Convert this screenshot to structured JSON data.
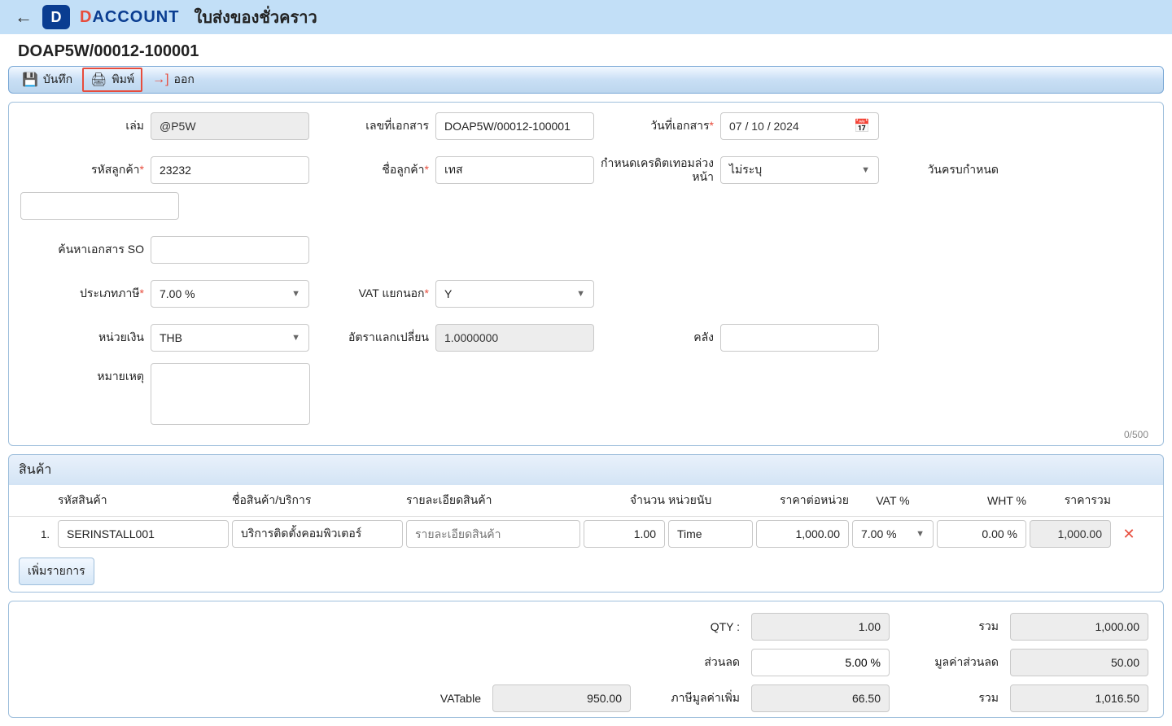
{
  "header": {
    "logo_letter": "D",
    "logo_text_d": "D",
    "logo_text_rest": "ACCOUNT",
    "page_title": "ใบส่งของชั่วคราว"
  },
  "doc_number": "DOAP5W/00012-100001",
  "toolbar": {
    "save": "บันทึก",
    "print": "พิมพ์",
    "exit": "ออก"
  },
  "form": {
    "labels": {
      "book": "เล่ม",
      "doc_no": "เลขที่เอกสาร",
      "doc_date": "วันที่เอกสาร",
      "cust_code": "รหัสลูกค้า",
      "cust_name": "ชื่อลูกค้า",
      "credit_term": "กำหนดเครดิตเทอมล่วงหน้า",
      "due_date": "วันครบกำหนด",
      "so_search": "ค้นหาเอกสาร SO",
      "tax_type": "ประเภทภาษี",
      "vat_sep": "VAT แยกนอก",
      "currency": "หน่วยเงิน",
      "exch_rate": "อัตราแลกเปลี่ยน",
      "warehouse": "คลัง",
      "remarks": "หมายเหตุ"
    },
    "values": {
      "book": "@P5W",
      "doc_no": "DOAP5W/00012-100001",
      "doc_date_d": "07",
      "doc_date_m": "10",
      "doc_date_y": "2024",
      "cust_code": "23232",
      "cust_name": "เทส",
      "credit_term": "ไม่ระบุ",
      "due_date": "",
      "so_search": "",
      "tax_type": "7.00 %",
      "vat_sep": "Y",
      "currency": "THB",
      "exch_rate": "1.0000000",
      "warehouse": "",
      "remarks": ""
    },
    "charcount": "0/500"
  },
  "products": {
    "section_title": "สินค้า",
    "headers": {
      "code": "รหัสสินค้า",
      "name": "ชื่อสินค้า/บริการ",
      "detail": "รายละเอียดสินค้า",
      "qty": "จำนวน",
      "unit": "หน่วยนับ",
      "price": "ราคาต่อหน่วย",
      "vat": "VAT %",
      "wht": "WHT %",
      "total": "ราคารวม"
    },
    "detail_placeholder": "รายละเอียดสินค้า",
    "rows": [
      {
        "idx": "1.",
        "code": "SERINSTALL001",
        "name": "บริการติดตั้งคอมพิวเตอร์",
        "detail": "",
        "qty": "1.00",
        "unit": "Time",
        "price": "1,000.00",
        "vat": "7.00 %",
        "wht": "0.00 %",
        "total": "1,000.00"
      }
    ],
    "add_row": "เพิ่มรายการ"
  },
  "summary": {
    "labels": {
      "qty": "QTY :",
      "sum": "รวม",
      "discount": "ส่วนลด",
      "discount_value": "มูลค่าส่วนลด",
      "vatable": "VATable",
      "vat_amount": "ภาษีมูลค่าเพิ่ม",
      "grand": "รวม"
    },
    "values": {
      "qty": "1.00",
      "sum": "1,000.00",
      "discount": "5.00 %",
      "discount_value": "50.00",
      "vatable": "950.00",
      "vat_amount": "66.50",
      "grand": "1,016.50"
    }
  }
}
